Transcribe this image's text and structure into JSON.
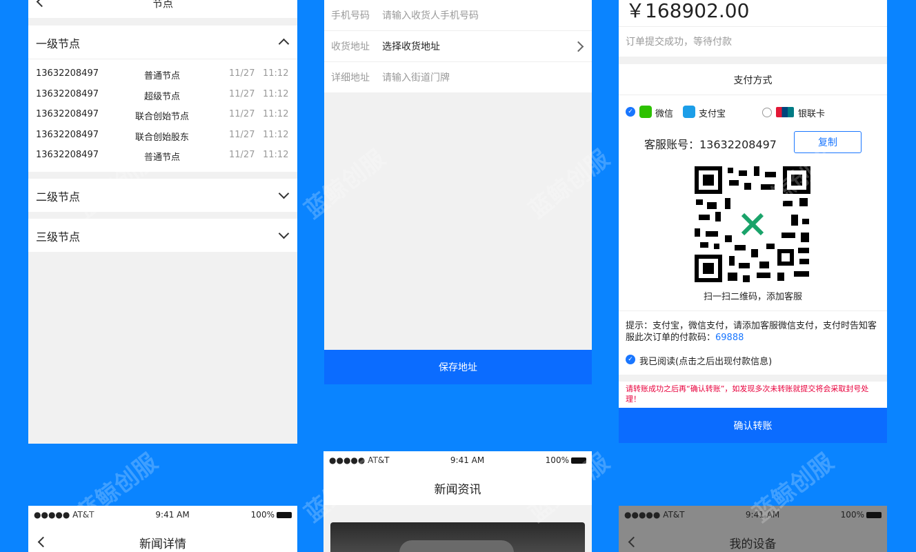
{
  "watermark": "蓝鲸创服",
  "nodes": {
    "title": "节点",
    "level1": "一级节点",
    "rows": [
      {
        "phone": "13632208497",
        "type": "普通节点",
        "date": "11/27",
        "time": "11:12"
      },
      {
        "phone": "13632208497",
        "type": "超级节点",
        "date": "11/27",
        "time": "11:12"
      },
      {
        "phone": "13632208497",
        "type": "联合创始节点",
        "date": "11/27",
        "time": "11:12"
      },
      {
        "phone": "13632208497",
        "type": "联合创始股东",
        "date": "11/27",
        "time": "11:12"
      },
      {
        "phone": "13632208497",
        "type": "普通节点",
        "date": "11/27",
        "time": "11:12"
      }
    ],
    "level2": "二级节点",
    "level3": "三级节点"
  },
  "address": {
    "phone_label": "手机号码",
    "phone_placeholder": "请输入收货人手机号码",
    "region_label": "收货地址",
    "region_value": "选择收货地址",
    "detail_label": "详细地址",
    "detail_placeholder": "请输入街道门牌",
    "save_button": "保存地址"
  },
  "payment": {
    "amount": "￥168902.00",
    "status": "订单提交成功，等待付款",
    "method_title": "支付方式",
    "wechat": "微信",
    "alipay": "支付宝",
    "unionpay": "银联卡",
    "service_label": "客服账号：13632208497",
    "copy_button": "复制",
    "qr_caption": "扫一扫二维码，添加客服",
    "tip": "提示：支付宝，微信支付，请添加客服微信支付，支付时告知客服此次订单的付款码：",
    "pay_code": "69888",
    "read_label": "我已阅读(点击之后出现付款信息)",
    "warning": "请转账成功之后再“确认转账”，如发现多次未转账就提交将会采取封号处理！",
    "confirm_button": "确认转账"
  },
  "status_bar": {
    "carrier": "●●●●● AT&T",
    "time": "9:41 AM",
    "battery": "100%"
  },
  "news_list": {
    "title": "新闻资讯"
  },
  "news_detail": {
    "title": "新闻详情"
  },
  "device": {
    "title": "我的设备"
  }
}
